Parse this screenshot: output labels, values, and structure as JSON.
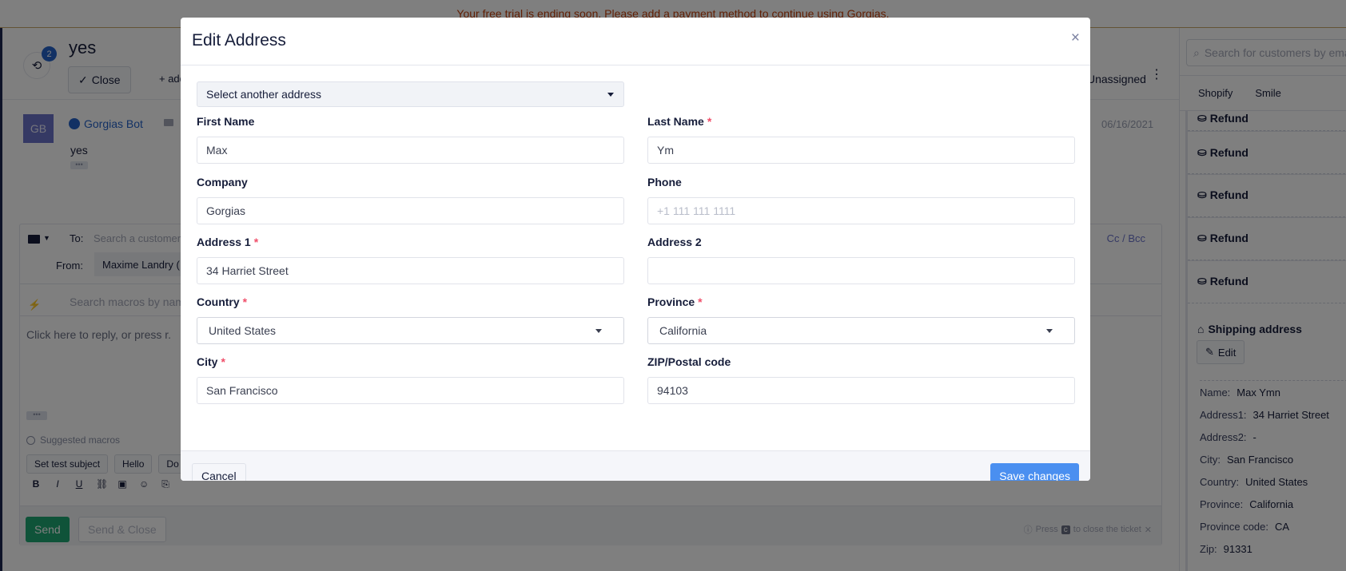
{
  "banner": {
    "text": "Your free trial is ending soon. Please add a payment method to continue using Gorgias."
  },
  "ticket": {
    "title": "yes",
    "history_count": "2",
    "close_label": "Close",
    "add_tag_label": "+ add tags",
    "assignee": "Unassigned",
    "message": {
      "avatar_initials": "GB",
      "sender": "Gorgias Bot",
      "body": "yes",
      "date": "06/16/2021"
    },
    "composer": {
      "to_label": "To:",
      "to_placeholder": "Search a customer",
      "cc_bcc": "Cc / Bcc",
      "from_label": "From:",
      "from_value": "Maxime Landry (",
      "macro_placeholder": "Search macros by name",
      "reply_placeholder": "Click here to reply, or press r.",
      "suggested_label": "Suggested macros",
      "macros": [
        "Set test subject",
        "Hello",
        "Do"
      ],
      "send_label": "Send",
      "send_close_label": "Send & Close",
      "hint_prefix": "Press",
      "hint_key": "c",
      "hint_suffix": "to close the ticket"
    }
  },
  "sidebar": {
    "search_placeholder": "Search for customers by email",
    "tabs": [
      "Shopify",
      "Smile"
    ],
    "refunds": [
      "Refund",
      "Refund",
      "Refund",
      "Refund",
      "Refund"
    ],
    "shipping_title": "Shipping address",
    "edit_label": "Edit",
    "shipping": [
      {
        "key": "Name:",
        "value": "Max Ymn"
      },
      {
        "key": "Address1:",
        "value": "34 Harriet Street"
      },
      {
        "key": "Address2:",
        "value": "-"
      },
      {
        "key": "City:",
        "value": "San Francisco"
      },
      {
        "key": "Country:",
        "value": "United States"
      },
      {
        "key": "Province:",
        "value": "California"
      },
      {
        "key": "Province code:",
        "value": "CA"
      },
      {
        "key": "Zip:",
        "value": "91331"
      }
    ]
  },
  "modal": {
    "title": "Edit Address",
    "close_icon": "×",
    "select_address": "Select another address",
    "fields": {
      "first_name": {
        "label": "First Name",
        "value": "Max",
        "required": false
      },
      "last_name": {
        "label": "Last Name",
        "value": "Ym",
        "required": true
      },
      "company": {
        "label": "Company",
        "value": "Gorgias",
        "required": false
      },
      "phone": {
        "label": "Phone",
        "value": "",
        "placeholder": "+1 111 111 1111",
        "required": false
      },
      "address1": {
        "label": "Address 1",
        "value": "34 Harriet Street",
        "required": true
      },
      "address2": {
        "label": "Address 2",
        "value": "",
        "required": false
      },
      "country": {
        "label": "Country",
        "value": "United States",
        "required": true
      },
      "province": {
        "label": "Province",
        "value": "California",
        "required": true
      },
      "city": {
        "label": "City",
        "value": "San Francisco",
        "required": true
      },
      "zip": {
        "label": "ZIP/Postal code",
        "value": "94103",
        "required": false
      }
    },
    "required_mark": "*",
    "cancel_label": "Cancel",
    "save_label": "Save changes"
  },
  "colors": {
    "primary": "#4a8ff0",
    "send_green": "#1ea672",
    "required_red": "#f04f6a",
    "banner_text": "#c2410c",
    "navy_text": "#161d3a"
  }
}
